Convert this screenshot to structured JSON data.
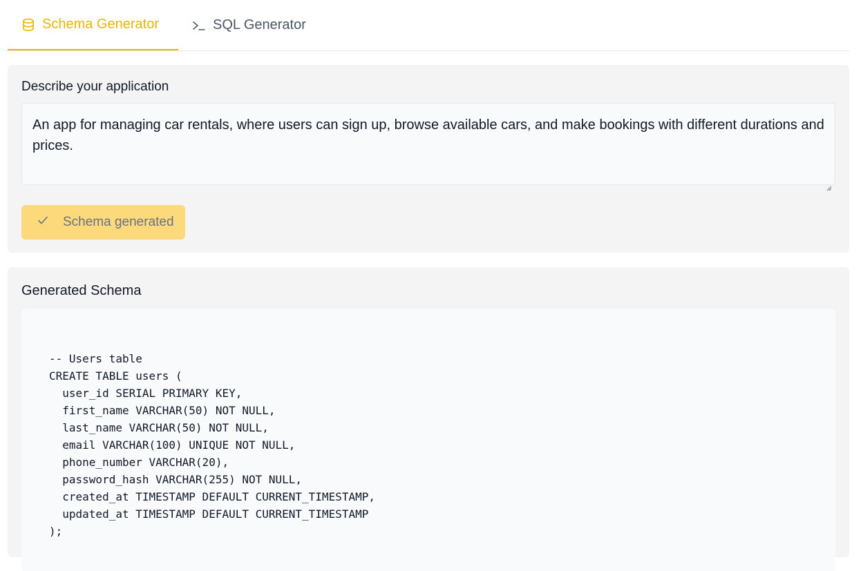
{
  "tabs": [
    {
      "label": "Schema Generator",
      "icon": "database-icon",
      "active": true
    },
    {
      "label": "SQL Generator",
      "icon": "terminal-icon",
      "active": false
    }
  ],
  "describe": {
    "label": "Describe your application",
    "value": "An app for managing car rentals, where users can sign up, browse available cars, and make bookings with different durations and prices."
  },
  "generate_button": {
    "label": "Schema generated",
    "icon": "check-icon"
  },
  "schema": {
    "title": "Generated Schema",
    "lines": [
      "-- Users table",
      "CREATE TABLE users (",
      "  user_id SERIAL PRIMARY KEY,",
      "  first_name VARCHAR(50) NOT NULL,",
      "  last_name VARCHAR(50) NOT NULL,",
      "  email VARCHAR(100) UNIQUE NOT NULL,",
      "  phone_number VARCHAR(20),",
      "  password_hash VARCHAR(255) NOT NULL,",
      "  created_at TIMESTAMP DEFAULT CURRENT_TIMESTAMP,",
      "  updated_at TIMESTAMP DEFAULT CURRENT_TIMESTAMP",
      ");"
    ]
  },
  "colors": {
    "accent": "#eab308",
    "button_bg": "#fcd97a",
    "panel_bg": "#f4f4f5"
  }
}
